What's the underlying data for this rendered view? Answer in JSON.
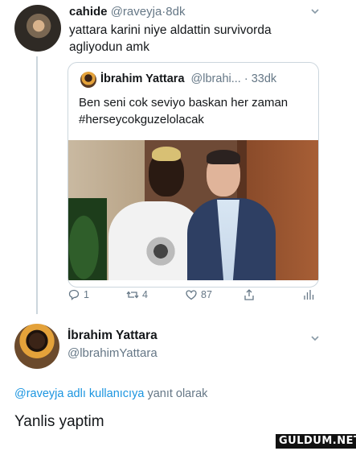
{
  "tweet1": {
    "display_name": "cahide",
    "handle": "@raveyja",
    "dot": "·",
    "time": "8dk",
    "text": "yattara karini niye aldattin survivorda agliyodun amk",
    "avatar_icon": "user-avatar"
  },
  "quoted": {
    "display_name": "İbrahim Yattara",
    "handle": "@lbrahi...",
    "dot": "·",
    "time": "33dk",
    "text": "Ben seni cok seviyo baskan her zaman #herseycokguzelolacak",
    "photo_icon": "two-men-photo"
  },
  "actions": {
    "reply_count": "1",
    "retweet_count": "4",
    "like_count": "87"
  },
  "tweet2": {
    "display_name": "İbrahim Yattara",
    "handle": "@lbrahimYattara",
    "reply_link": "@raveyja adlı kullanıcıya",
    "reply_suffix": "yanıt olarak",
    "text": "Yanlis yaptim"
  },
  "watermark": "GULDUM.NET",
  "colors": {
    "text": "#14171a",
    "muted": "#657786",
    "link": "#1b95e0",
    "border": "#ccd6dd"
  }
}
